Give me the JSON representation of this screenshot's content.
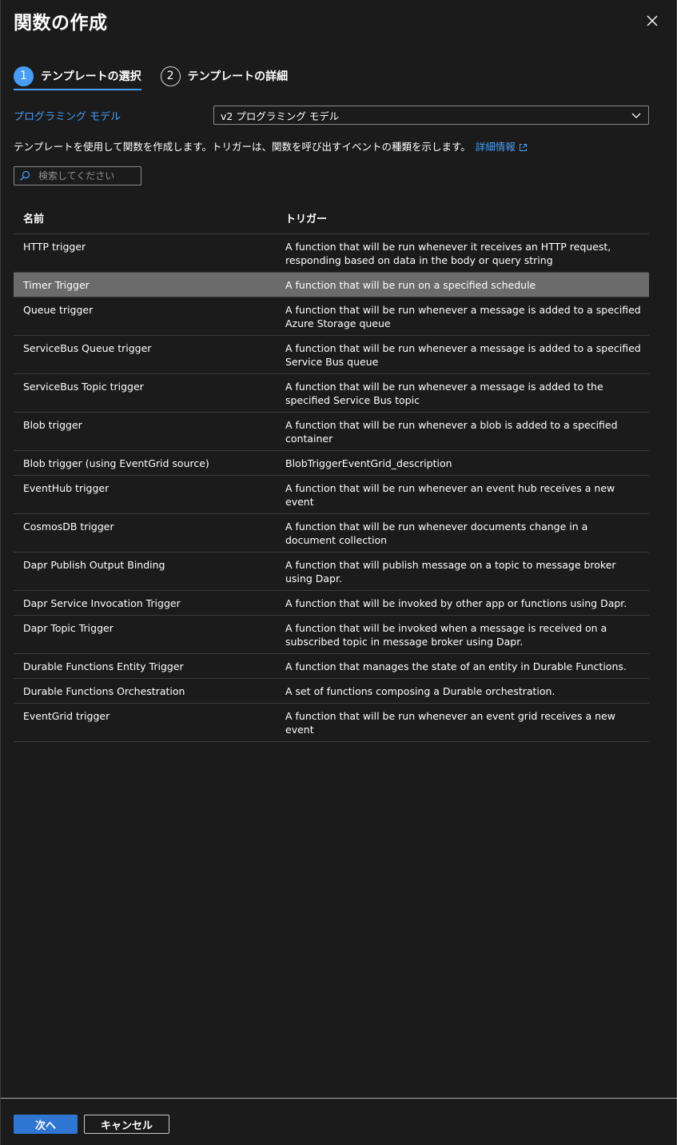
{
  "header": {
    "title": "関数の作成"
  },
  "wizard": {
    "steps": [
      {
        "number": "1",
        "label": "テンプレートの選択",
        "active": true
      },
      {
        "number": "2",
        "label": "テンプレートの詳細",
        "active": false
      }
    ]
  },
  "model": {
    "label": "プログラミング モデル",
    "selected": "v2 プログラミング モデル"
  },
  "description": {
    "text": "テンプレートを使用して関数を作成します。トリガーは、関数を呼び出すイベントの種類を示します。",
    "link": "詳細情報"
  },
  "search": {
    "placeholder": "検索してください",
    "value": ""
  },
  "table": {
    "headers": {
      "name": "名前",
      "trigger": "トリガー"
    },
    "rows": [
      {
        "name": "HTTP trigger",
        "description": "A function that will be run whenever it receives an HTTP request, responding based on data in the body or query string"
      },
      {
        "name": "Timer Trigger",
        "description": "A function that will be run on a specified schedule"
      },
      {
        "name": "Queue trigger",
        "description": "A function that will be run whenever a message is added to a specified Azure Storage queue"
      },
      {
        "name": "ServiceBus Queue trigger",
        "description": "A function that will be run whenever a message is added to a specified Service Bus queue"
      },
      {
        "name": "ServiceBus Topic trigger",
        "description": "A function that will be run whenever a message is added to the specified Service Bus topic"
      },
      {
        "name": "Blob trigger",
        "description": "A function that will be run whenever a blob is added to a specified container"
      },
      {
        "name": "Blob trigger (using EventGrid source)",
        "description": "BlobTriggerEventGrid_description"
      },
      {
        "name": "EventHub trigger",
        "description": "A function that will be run whenever an event hub receives a new event"
      },
      {
        "name": "CosmosDB trigger",
        "description": "A function that will be run whenever documents change in a document collection"
      },
      {
        "name": "Dapr Publish Output Binding",
        "description": "A function that will publish message on a topic to message broker using Dapr."
      },
      {
        "name": "Dapr Service Invocation Trigger",
        "description": "A function that will be invoked by other app or functions using Dapr."
      },
      {
        "name": "Dapr Topic Trigger",
        "description": "A function that will be invoked when a message is received on a subscribed topic in message broker using Dapr."
      },
      {
        "name": "Durable Functions Entity Trigger",
        "description": "A function that manages the state of an entity in Durable Functions."
      },
      {
        "name": "Durable Functions Orchestration",
        "description": "A set of functions composing a Durable orchestration."
      },
      {
        "name": "EventGrid trigger",
        "description": "A function that will be run whenever an event grid receives a new event"
      }
    ],
    "selected_row": "Timer Trigger"
  },
  "footer": {
    "next_label": "次へ",
    "cancel_label": "キャンセル"
  },
  "colors": {
    "accent": "#479ef5",
    "primary_button": "#2f76d2",
    "selected_row": "#6b6b6b",
    "background": "#1b1b1b"
  }
}
